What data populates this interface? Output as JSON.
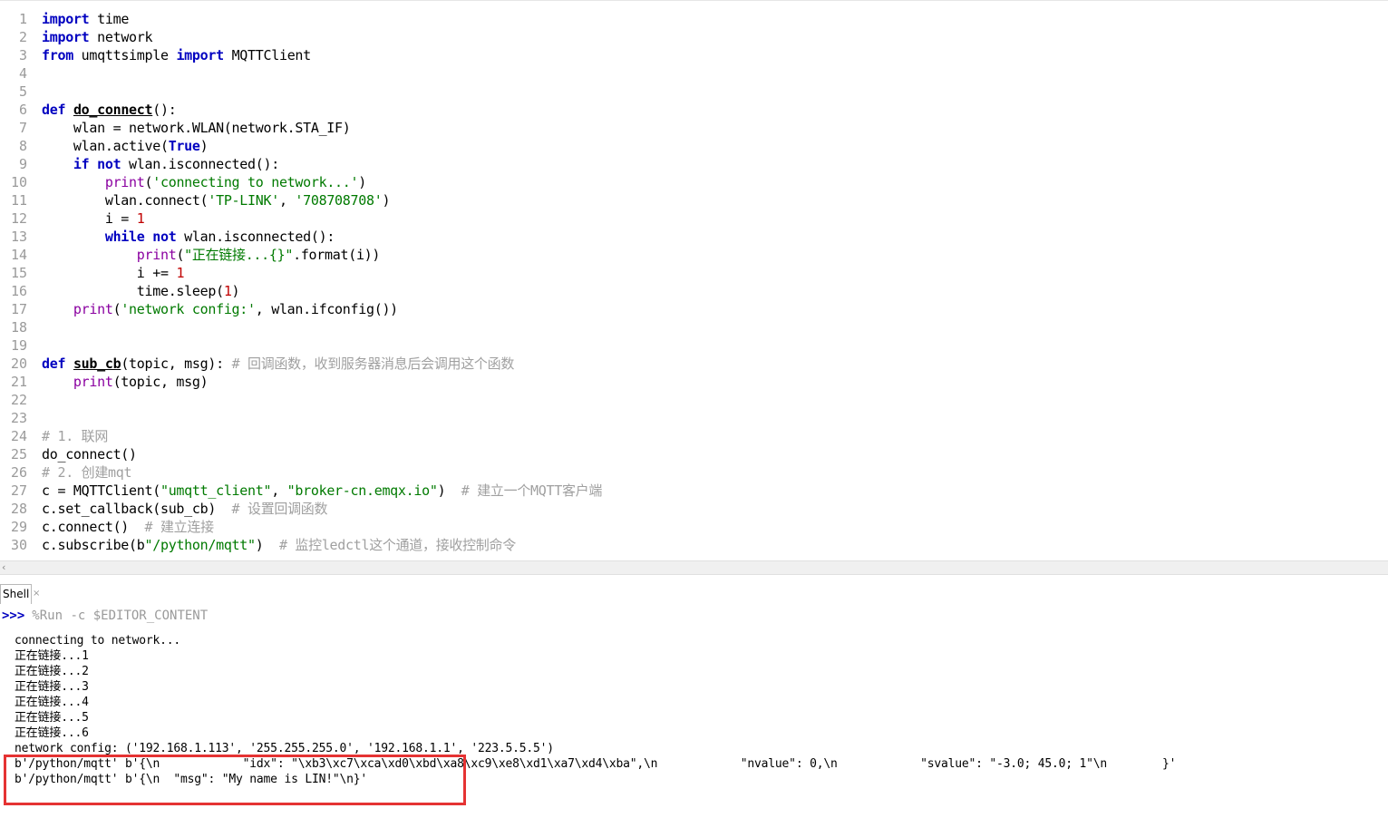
{
  "editor": {
    "line_numbers": [
      "1",
      "2",
      "3",
      "4",
      "5",
      "6",
      "7",
      "8",
      "9",
      "10",
      "11",
      "12",
      "13",
      "14",
      "15",
      "16",
      "17",
      "18",
      "19",
      "20",
      "21",
      "22",
      "23",
      "24",
      "25",
      "26",
      "27",
      "28",
      "29",
      "30"
    ]
  },
  "code": {
    "l1_k": "import",
    "l1_r": " time",
    "l2_k": "import",
    "l2_r": " network",
    "l3_k1": "from",
    "l3_m": " umqttsimple ",
    "l3_k2": "import",
    "l3_r": " MQTTClient",
    "l6_k": "def",
    "l6_f": "do_connect",
    "l6_r": "():",
    "l7": "    wlan = network.WLAN(network.STA_IF)",
    "l8_a": "    wlan.active(",
    "l8_k": "True",
    "l8_b": ")",
    "l9_k1": "    if",
    "l9_k2": " not",
    "l9_r": " wlan.isconnected():",
    "l10_b": "        print",
    "l10_a": "(",
    "l10_s": "'connecting to network...'",
    "l10_c": ")",
    "l11_a": "        wlan.connect(",
    "l11_s1": "'TP-LINK'",
    "l11_m": ", ",
    "l11_s2": "'708708708'",
    "l11_b": ")",
    "l12_a": "        i = ",
    "l12_n": "1",
    "l13_k1": "        while",
    "l13_k2": " not",
    "l13_r": " wlan.isconnected():",
    "l14_b": "            print",
    "l14_a": "(",
    "l14_s": "\"正在链接...{}\"",
    "l14_c": ".format(i))",
    "l15_a": "            i += ",
    "l15_n": "1",
    "l16_a": "            time.sleep(",
    "l16_n": "1",
    "l16_b": ")",
    "l17_b": "    print",
    "l17_a": "(",
    "l17_s": "'network config:'",
    "l17_c": ", wlan.ifconfig())",
    "l20_k": "def",
    "l20_f": "sub_cb",
    "l20_r": "(topic, msg): ",
    "l20_c": "# 回调函数，收到服务器消息后会调用这个函数",
    "l21_b": "    print",
    "l21_r": "(topic, msg)",
    "l24_c": "# 1. 联网",
    "l25": "do_connect()",
    "l26_c": "# 2. 创建mqt",
    "l27_a": "c = MQTTClient(",
    "l27_s1": "\"umqtt_client\"",
    "l27_m": ", ",
    "l27_s2": "\"broker-cn.emqx.io\"",
    "l27_b": ")  ",
    "l27_c": "# 建立一个MQTT客户端",
    "l28_a": "c.set_callback(sub_cb)  ",
    "l28_c": "# 设置回调函数",
    "l29_a": "c.connect()  ",
    "l29_c": "# 建立连接",
    "l30_a": "c.subscribe(b",
    "l30_s": "\"/python/mqtt\"",
    "l30_b": ")  ",
    "l30_c": "# 监控ledctl这个通道，接收控制命令"
  },
  "tabs": {
    "shell_label": "Shell",
    "close_glyph": "×"
  },
  "shell": {
    "prompt": ">>>",
    "run_command": "%Run -c $EDITOR_CONTENT",
    "output_lines": [
      "connecting to network...",
      "正在链接...1",
      "正在链接...2",
      "正在链接...3",
      "正在链接...4",
      "正在链接...5",
      "正在链接...6",
      "network config: ('192.168.1.113', '255.255.255.0', '192.168.1.1', '223.5.5.5')",
      "b'/python/mqtt' b'{\\n            \"idx\": \"\\xb3\\xc7\\xca\\xd0\\xbd\\xa8\\xc9\\xe8\\xd1\\xa7\\xd4\\xba\",\\n            \"nvalue\": 0,\\n            \"svalue\": \"-3.0; 45.0; 1\"\\n        }'",
      "b'/python/mqtt' b'{\\n  \"msg\": \"My name is LIN!\"\\n}'"
    ]
  },
  "scroll": {
    "left_arrow": "‹"
  },
  "colors": {
    "keyword": "#0000c0",
    "string": "#007a00",
    "number": "#c00000",
    "comment": "#a0a0a0",
    "highlight_box": "#e53333"
  }
}
